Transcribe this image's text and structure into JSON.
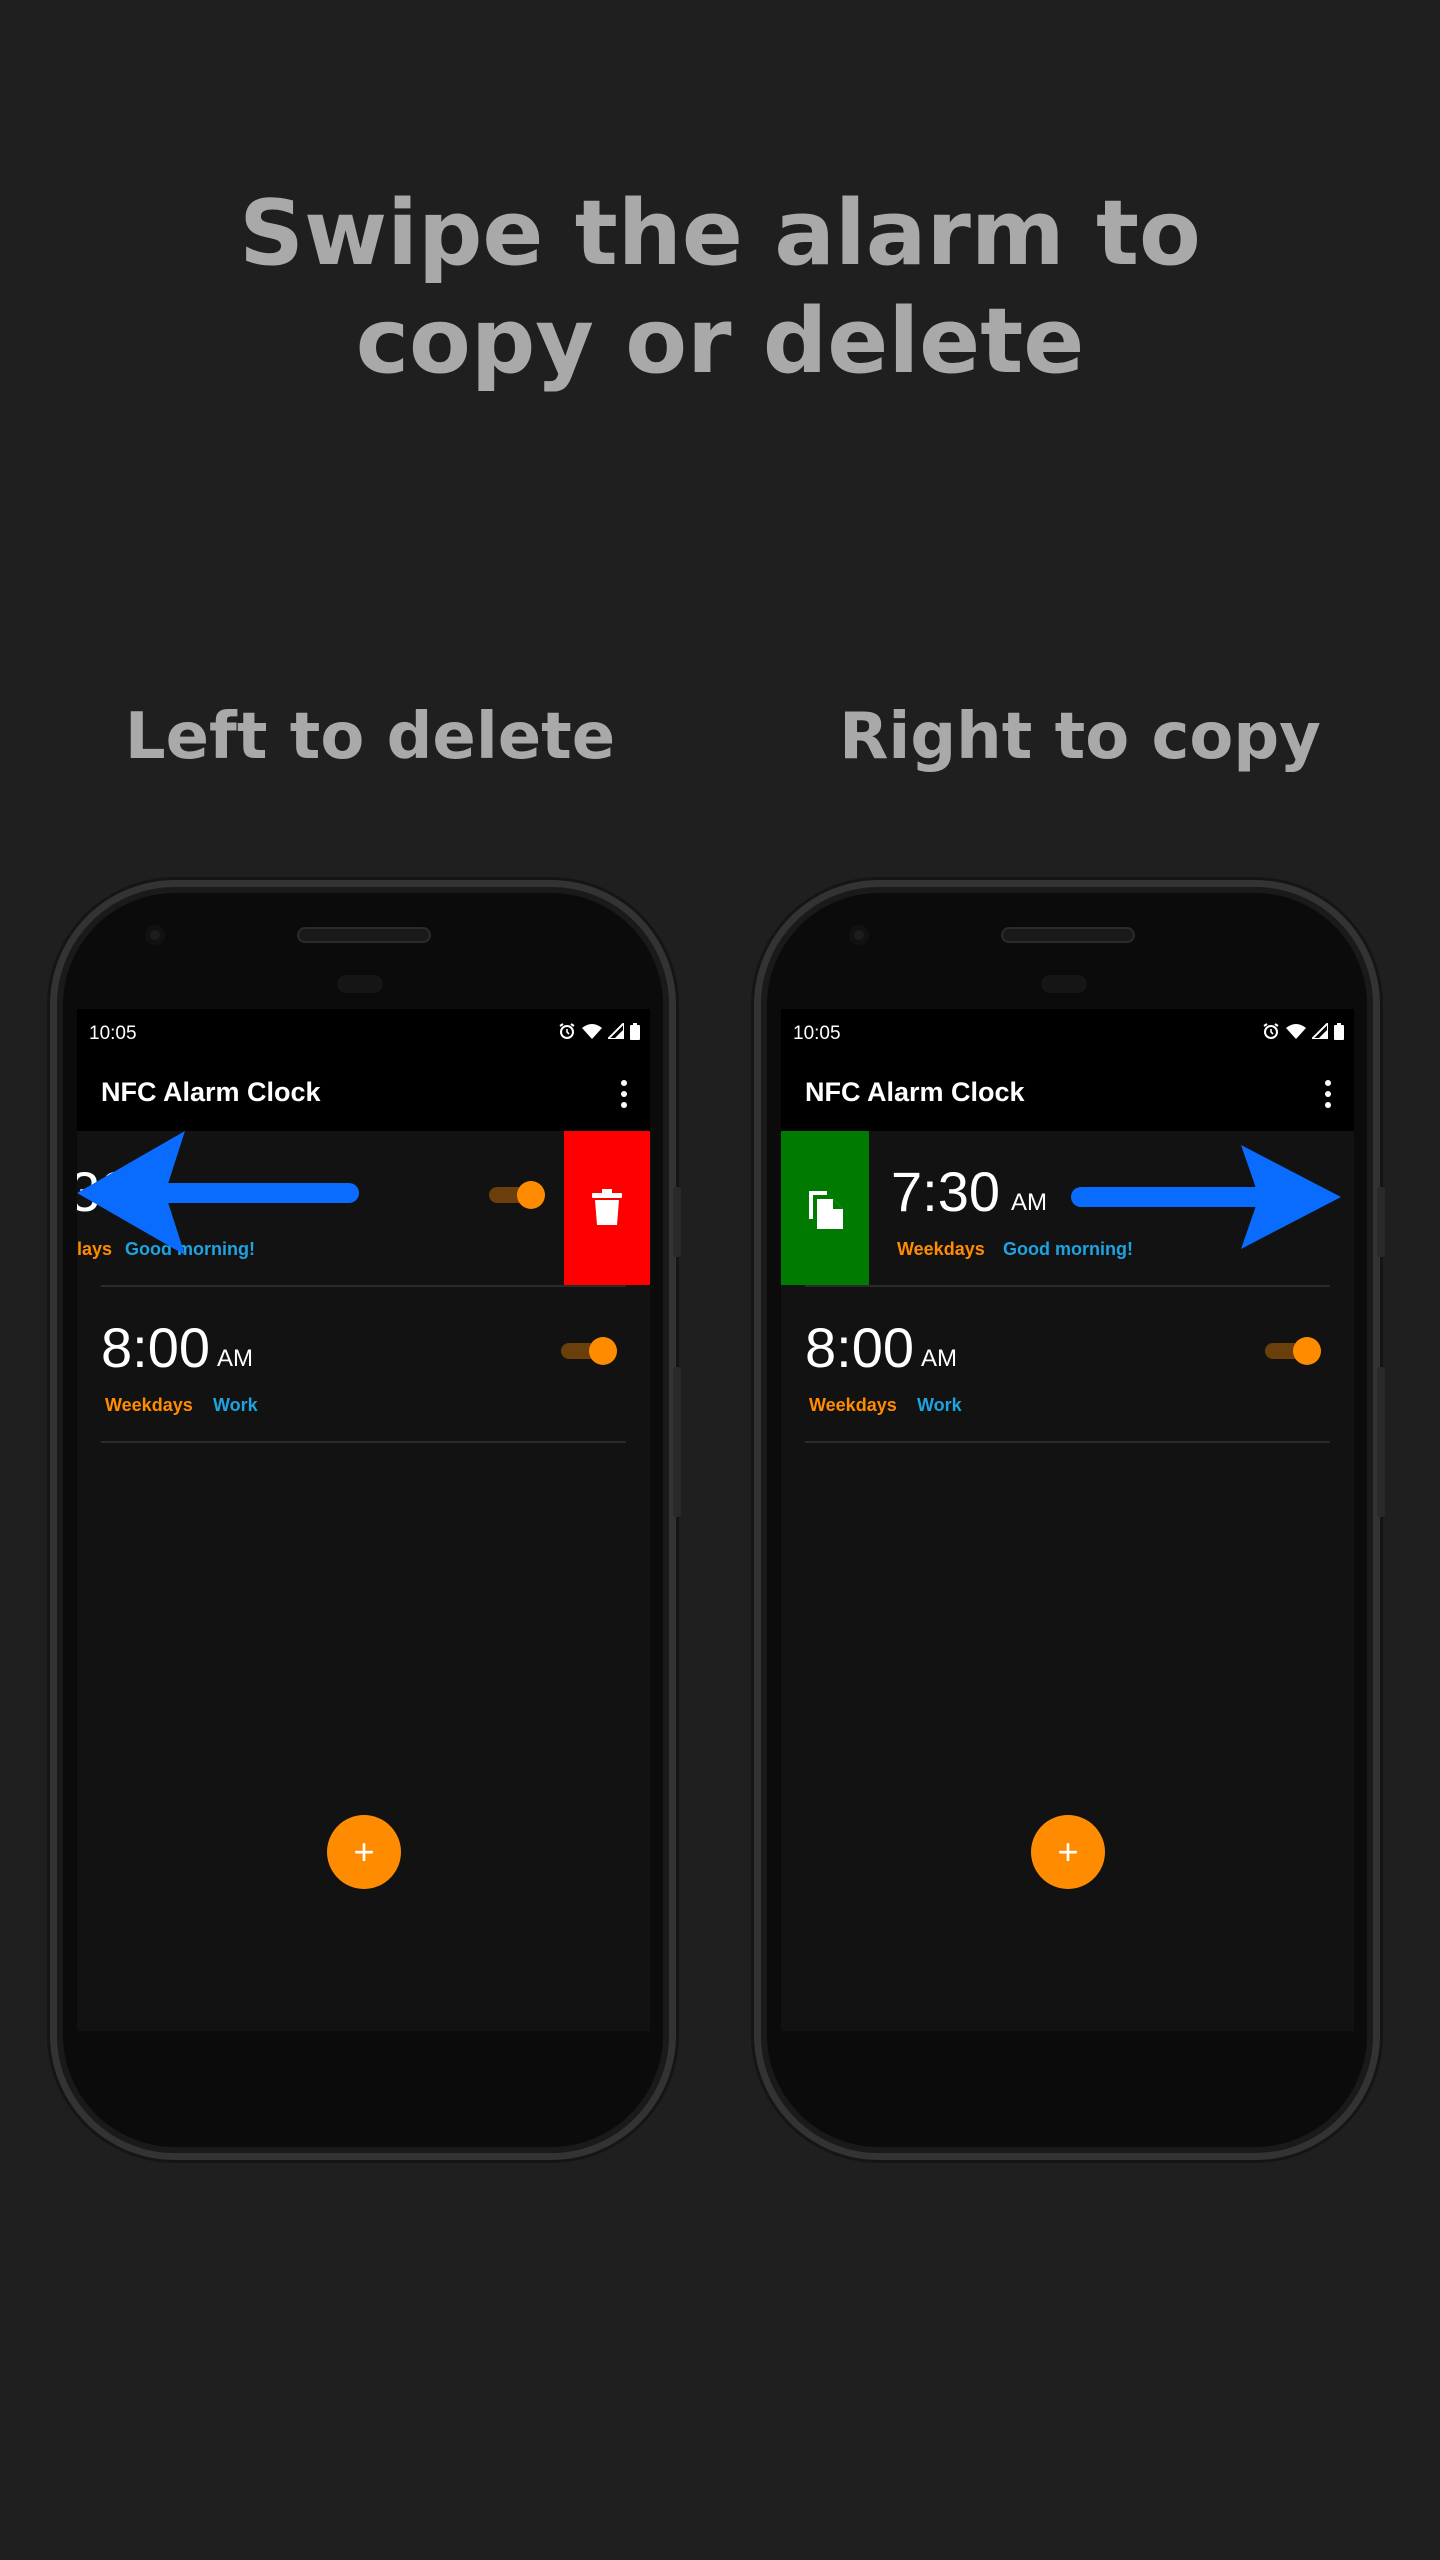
{
  "headline": {
    "line1": "Swipe the alarm to",
    "line2": "copy or delete"
  },
  "subheads": {
    "left": "Left to delete",
    "right": "Right to copy"
  },
  "phones": [
    {
      "status_time": "10:05",
      "app_title": "NFC Alarm Clock",
      "alarms": [
        {
          "time": "30",
          "ampm": "",
          "days": "lays",
          "label": "Good morning!",
          "enabled": true,
          "swipe_action": "delete"
        },
        {
          "time": "8:00",
          "ampm": "AM",
          "days": "Weekdays",
          "label": "Work",
          "enabled": true
        }
      ],
      "fab": "+"
    },
    {
      "status_time": "10:05",
      "app_title": "NFC Alarm Clock",
      "alarms": [
        {
          "time": "7:30",
          "ampm": "AM",
          "days": "Weekdays",
          "label": "Good morning!",
          "enabled": true,
          "swipe_action": "copy"
        },
        {
          "time": "8:00",
          "ampm": "AM",
          "days": "Weekdays",
          "label": "Work",
          "enabled": true
        }
      ],
      "fab": "+"
    }
  ],
  "colors": {
    "accent": "#ff8c00",
    "label_blue": "#1fa3e0",
    "delete_red": "#ff0000",
    "copy_green": "#007a00",
    "arrow_blue": "#0a6cff"
  },
  "icons": [
    "alarm-icon",
    "wifi-icon",
    "signal-icon",
    "battery-icon",
    "more-vert-icon",
    "trash-icon",
    "copy-icon",
    "add-icon"
  ]
}
